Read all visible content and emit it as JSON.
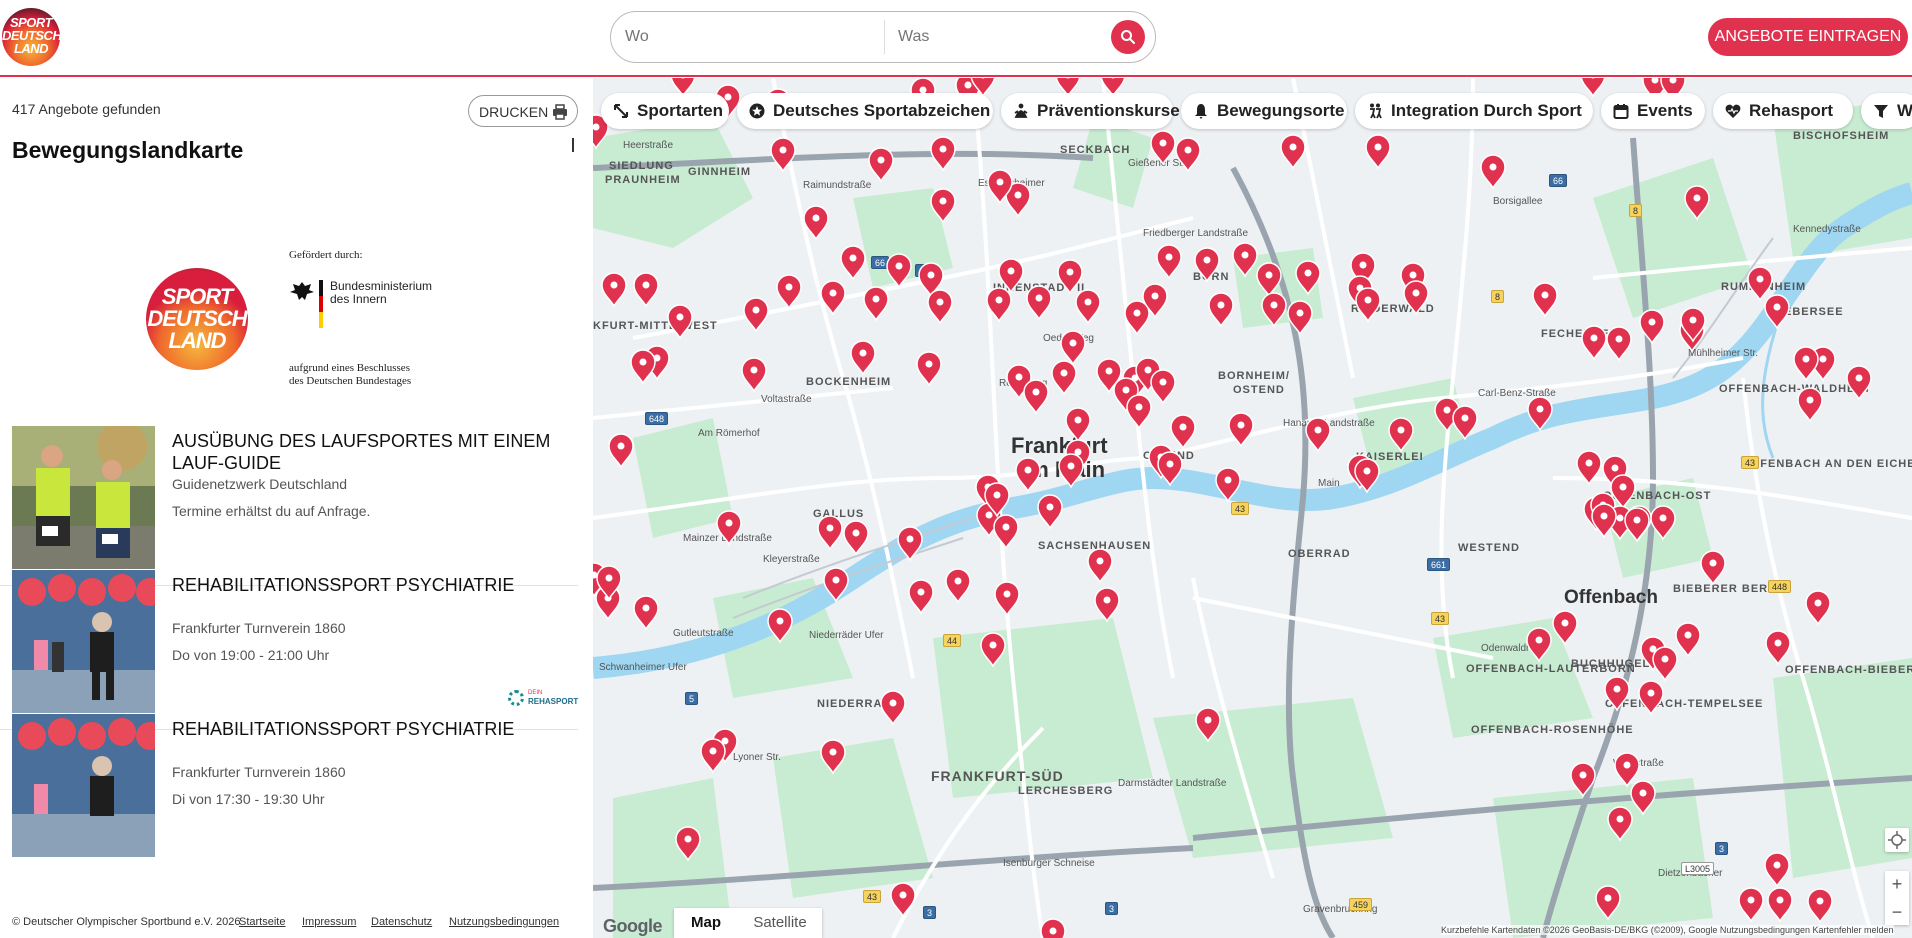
{
  "header": {
    "logo_text": [
      "SPORT",
      "DEUTSCH",
      "LAND"
    ],
    "search_where_placeholder": "Wo",
    "search_what_placeholder": "Was",
    "cta_label": "ANGEBOTE EINTRAGEN"
  },
  "left": {
    "count_label": "417 Angebote gefunden",
    "print_label": "DRUCKEN",
    "title": "Bewegungslandkarte",
    "promo": {
      "logo_text": [
        "SPORT",
        "DEUTSCH",
        "LAND"
      ],
      "funded_by": "Gefördert durch:",
      "ministry_lines": [
        "Bundesministerium",
        "des Innern"
      ],
      "decision_lines": [
        "aufgrund eines Beschlusses",
        "des Deutschen Bundestages"
      ]
    },
    "offers": [
      {
        "title": "AUSÜBUNG DES LAUFSPORTES MIT EINEM LAUF-GUIDE",
        "organization": "Guidenetzwerk Deutschland",
        "schedule": "Termine erhältst du auf Anfrage."
      },
      {
        "title": "REHABILITATIONSSPORT PSYCHIATRIE",
        "organization": "Frankfurter Turnverein 1860",
        "schedule": "Do von 19:00 - 21:00 Uhr",
        "badge_top": "DEIN",
        "badge_bottom": "REHASPORT"
      },
      {
        "title": "REHABILITATIONSSPORT PSYCHIATRIE",
        "organization": "Frankfurter Turnverein 1860",
        "schedule": "Di von 17:30 - 19:30 Uhr"
      }
    ]
  },
  "footer": {
    "copyright": "© Deutscher Olympischer Sportbund e.V. 2026",
    "links": [
      "Startseite",
      "Impressum",
      "Datenschutz",
      "Nutzungsbedingungen"
    ]
  },
  "map": {
    "filters": [
      "Sportarten",
      "Deutsches Sportabzeichen",
      "Präventionskurse",
      "Bewegungsorte",
      "Integration Durch Sport",
      "Events",
      "Rehasport",
      "W"
    ],
    "map_type": [
      "Map",
      "Satellite"
    ],
    "google_label": "Google",
    "zoom_in": "+",
    "zoom_out": "−",
    "attribution": "Kurzbefehle   Kartendaten ©2026 GeoBasis-DE/BKG (©2009), Google   Nutzungsbedingungen   Kartenfehler melden",
    "city_labels": [
      "Frankfurt",
      "am Main",
      "Offenbach"
    ],
    "district_labels": [
      "SIEDLUNG",
      "PRAUNHEIM",
      "KFURT-MITTE-WEST",
      "INNENSTADT II",
      "BOCKENHEIM",
      "BORNHEIM/",
      "OSTEND",
      "KAISERLEI",
      "GALLUS",
      "SACHSENHAUSEN",
      "FRANKFURT-SÜD",
      "NIEDERRAD",
      "LERCHESBERG",
      "OFFENBACH-OST",
      "OFFENBACH-TEMPELSEE",
      "OFFENBACH-BIEBER",
      "OFFENBACH-LAUTERBORN",
      "OFFENBACH-ROSENHÖHE",
      "BIEBERSEE",
      "RUMPENHEIM",
      "FECHENHEIM",
      "RIEDERWALD",
      "OBERRAD",
      "WESTEND",
      "BUCHHUGEL",
      "BIEBERER BERG",
      "OFFENBACH-WALDHEIM",
      "OFFENBACH AN DEN EICHEN",
      "GINNHEIM",
      "SECKBACH",
      "BISCHOFSHEIM",
      "BORN",
      "OSTEND"
    ],
    "street_labels": [
      "Raimundstraße",
      "Voltastraße",
      "Mainzer Landstraße",
      "Kleyerstraße",
      "Gutleutstraße",
      "Niederräder Ufer",
      "Schwanheimer Ufer",
      "Lyoner Str.",
      "Isenburger Schneise",
      "Darmstädter Landstraße",
      "Gravenbruchring",
      "Hanauer Landstraße",
      "Carl-Benz-Straße",
      "Kennedystraße",
      "Borsigallee",
      "Mühlheimer Str.",
      "Waldstraße",
      "Dietzenbacher",
      "Odenwaldring",
      "Am Römerhof",
      "Gießener Str.",
      "Eschersheimer",
      "Friedberger Landstraße",
      "Oeder Weg",
      "Reuterweg",
      "Main",
      "Heerstraße"
    ],
    "road_numbers": [
      "66",
      "66",
      "66",
      "648",
      "5",
      "44",
      "43",
      "43",
      "661",
      "3",
      "3",
      "3",
      "43",
      "459",
      "448",
      "8",
      "8",
      "43",
      "L3005"
    ],
    "pin_color": "#e0324f"
  },
  "colors": {
    "accent": "#e0324f",
    "water": "#9fd6f2",
    "park": "#c8ecd2",
    "road": "#ffffff",
    "highway": "#9aa4ae"
  }
}
